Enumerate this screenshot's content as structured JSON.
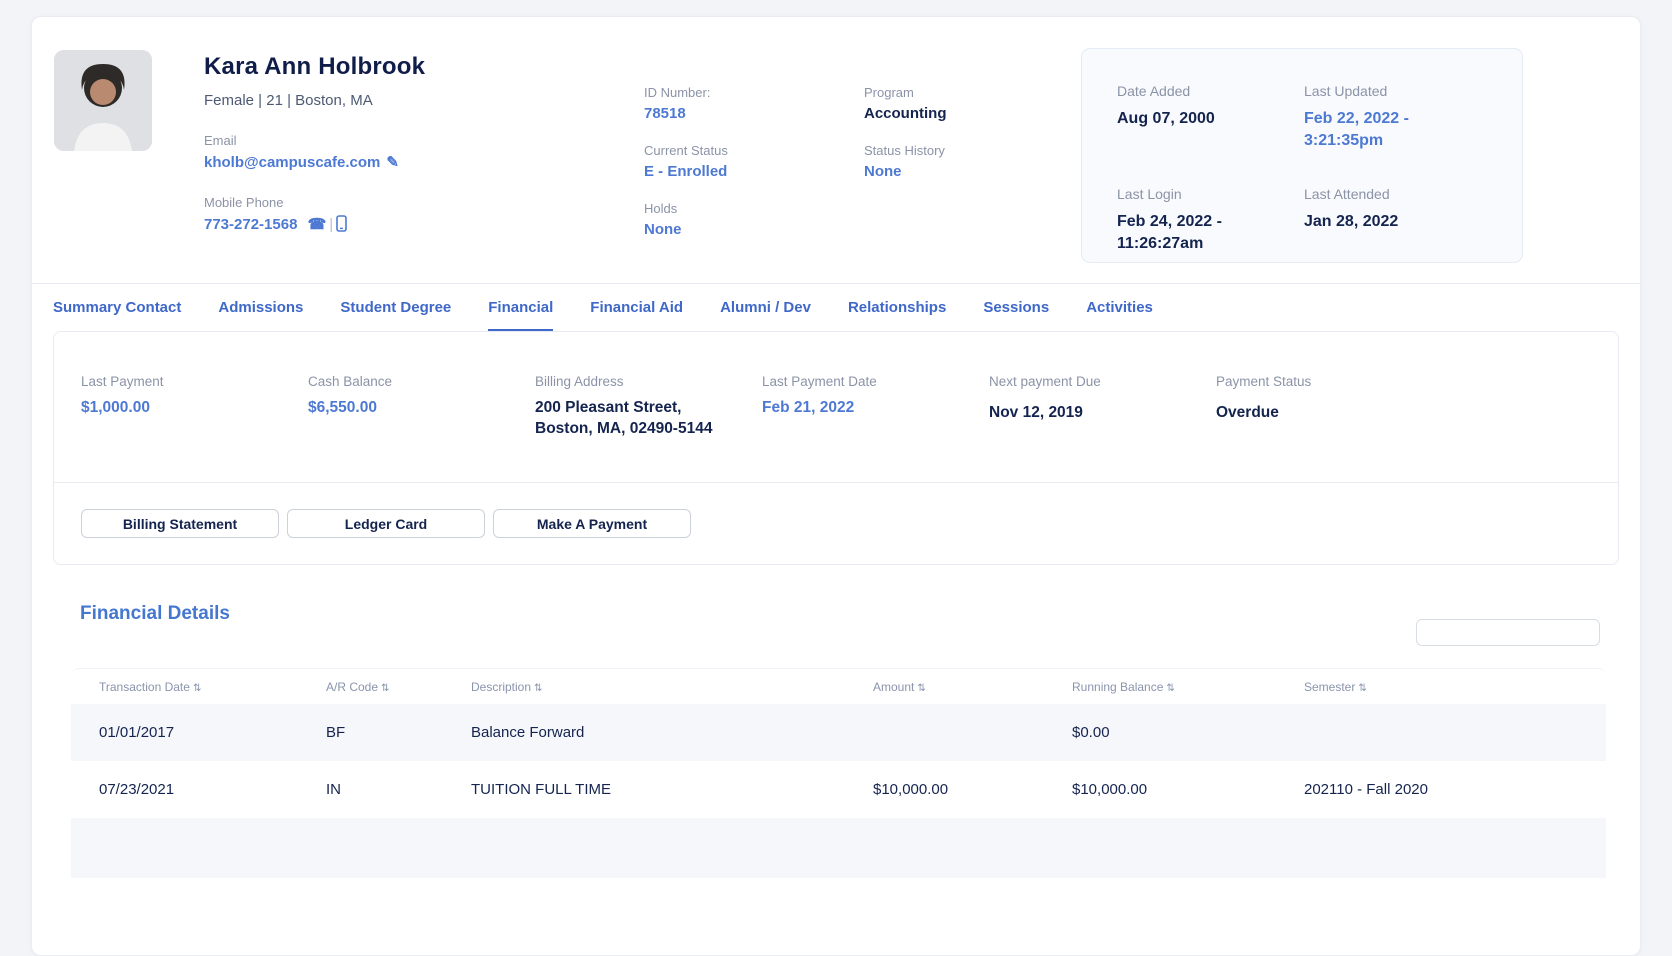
{
  "colors": {
    "accent_blue": "#4d79d3",
    "tab_blue": "#3f68c9",
    "navy": "#14244e",
    "label_gray": "#8b93a7",
    "stripe": "#f6f7fb"
  },
  "icons": {
    "edit": "✎",
    "phone": "☎",
    "separator": "|",
    "sort": "⇅"
  },
  "student": {
    "name": "Kara Ann Holbrook",
    "subtitle": "Female | 21 | Boston, MA",
    "email_label": "Email",
    "email": "kholb@campuscafe.com",
    "mobile_label": "Mobile Phone",
    "mobile": "773-272-1568",
    "id_label": "ID Number:",
    "id_value": "78518",
    "current_status_label": "Current Status",
    "current_status": "E - Enrolled",
    "holds_label": "Holds",
    "holds": "None",
    "program_label": "Program",
    "program": "Accounting",
    "status_history_label": "Status History",
    "status_history": "None"
  },
  "meta": {
    "date_added_label": "Date Added",
    "date_added": "Aug 07, 2000",
    "last_updated_label": "Last Updated",
    "last_updated": "Feb 22, 2022 - 3:21:35pm",
    "last_login_label": "Last Login",
    "last_login": "Feb 24, 2022 - 11:26:27am",
    "last_attended_label": "Last Attended",
    "last_attended": "Jan 28, 2022"
  },
  "tabs": {
    "items": [
      {
        "label": "Summary Contact"
      },
      {
        "label": "Admissions"
      },
      {
        "label": "Student Degree"
      },
      {
        "label": "Financial"
      },
      {
        "label": "Financial Aid"
      },
      {
        "label": "Alumni / Dev"
      },
      {
        "label": "Relationships"
      },
      {
        "label": "Sessions"
      },
      {
        "label": "Activities"
      }
    ],
    "active": "Financial"
  },
  "financial_summary": {
    "last_payment_label": "Last Payment",
    "last_payment": "$1,000.00",
    "cash_balance_label": "Cash Balance",
    "cash_balance": "$6,550.00",
    "billing_address_label": "Billing Address",
    "billing_address_line1": "200 Pleasant Street,",
    "billing_address_line2": "Boston, MA, 02490-5144",
    "last_payment_date_label": "Last Payment Date",
    "last_payment_date": "Feb 21, 2022",
    "next_payment_due_label": "Next payment Due",
    "next_payment_due": "Nov 12, 2019",
    "payment_status_label": "Payment Status",
    "payment_status": "Overdue"
  },
  "actions": {
    "billing_statement": "Billing Statement",
    "ledger_card": "Ledger Card",
    "make_a_payment": "Make A Payment"
  },
  "financial_details": {
    "title": "Financial Details",
    "search_value": "",
    "columns": [
      "Transaction Date",
      "A/R Code",
      "Description",
      "Amount",
      "Running Balance",
      "Semester"
    ],
    "rows": [
      [
        "01/01/2017",
        "BF",
        "Balance Forward",
        "",
        "$0.00",
        ""
      ],
      [
        "07/23/2021",
        "IN",
        "TUITION FULL TIME",
        "$10,000.00",
        "$10,000.00",
        "202110 - Fall 2020"
      ]
    ]
  }
}
